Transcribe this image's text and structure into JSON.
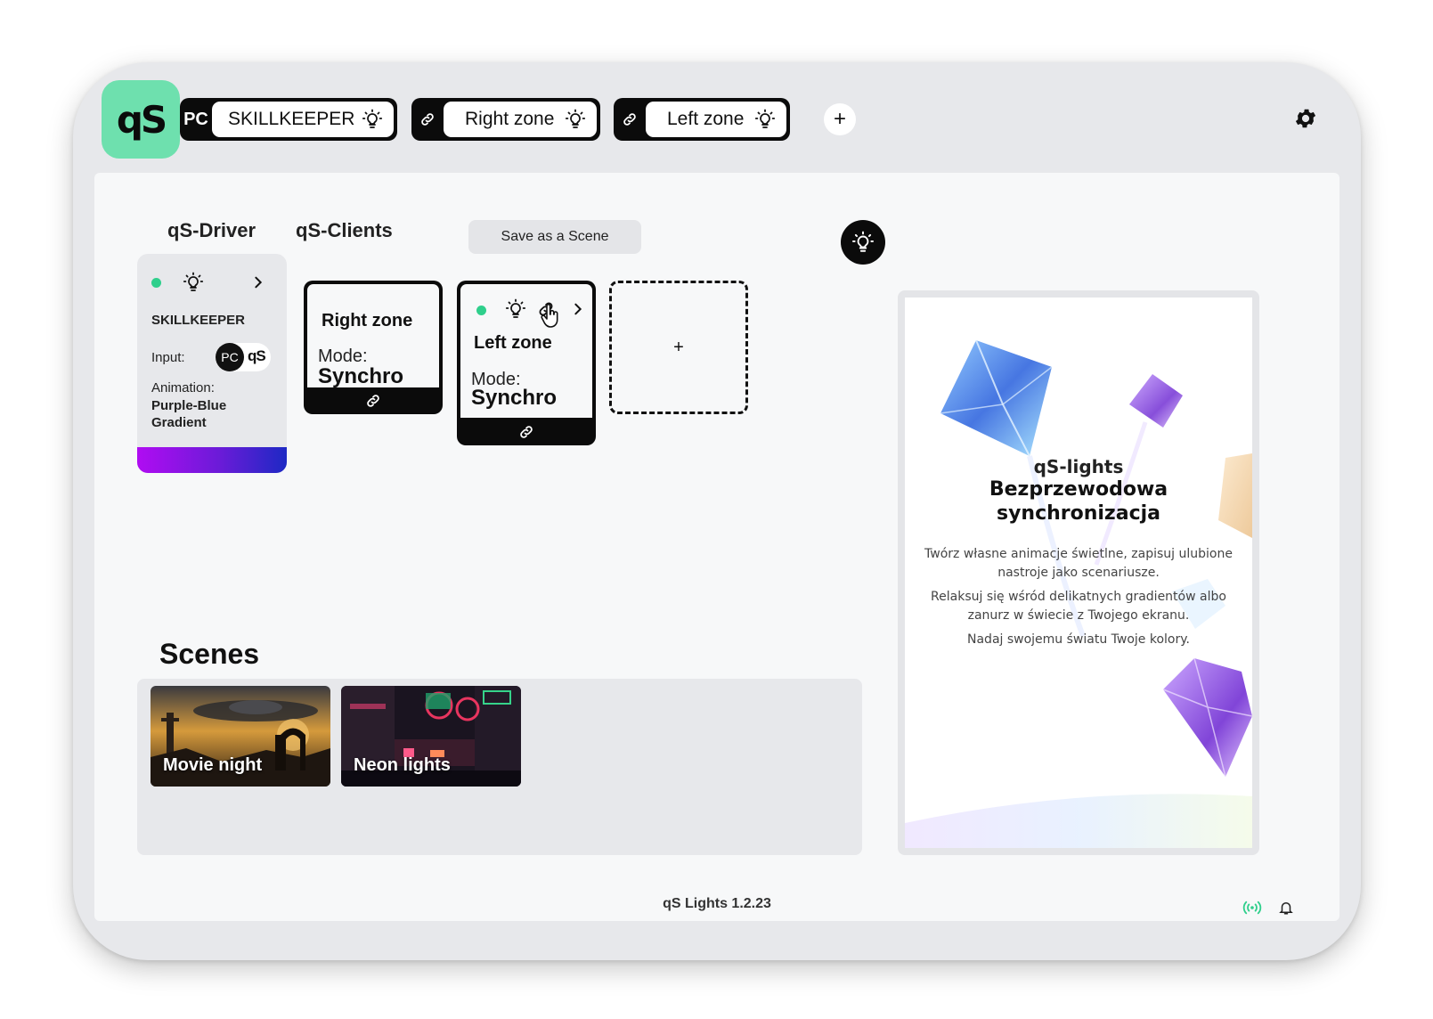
{
  "header": {
    "logo_text": "qS",
    "tabs": [
      {
        "lead": "PC",
        "label": "SKILLKEEPER"
      },
      {
        "lead": "link-icon",
        "label": "Right zone"
      },
      {
        "lead": "link-icon",
        "label": "Left zone"
      }
    ],
    "add_label": "+"
  },
  "main": {
    "section_tabs": [
      "qS-Driver",
      "qS-Clients"
    ],
    "save_scene_label": "Save as a Scene",
    "driver": {
      "name": "SKILLKEEPER",
      "input_label": "Input:",
      "input_pc": "PC",
      "input_qs": "qS",
      "animation_label": "Animation:",
      "animation_value": "Purple-Blue Gradient",
      "status_color": "#2fcf8c"
    },
    "clients": [
      {
        "title": "Right zone",
        "mode_label": "Mode:",
        "mode_value": "Synchro"
      },
      {
        "title": "Left zone",
        "mode_label": "Mode:",
        "mode_value": "Synchro"
      }
    ],
    "add_client_label": "+"
  },
  "scenes": {
    "title": "Scenes",
    "items": [
      {
        "label": "Movie night"
      },
      {
        "label": "Neon lights"
      }
    ]
  },
  "promo": {
    "brand": "qS-lights",
    "headline": "Bezprzewodowa synchronizacja",
    "paragraphs": [
      "Twórz własne animacje świetlne, zapisuj ulubione nastroje jako scenariusze.",
      "Relaksuj się wśród delikatnych gradientów albo zanurz w świecie z Twojego ekranu.",
      "Nadaj swojemu światu Twoje kolory."
    ]
  },
  "footer": {
    "version": "qS Lights 1.2.23"
  },
  "colors": {
    "accent": "#6ee0ae",
    "status_green": "#2fcf8c",
    "dark": "#0b0b0b"
  }
}
